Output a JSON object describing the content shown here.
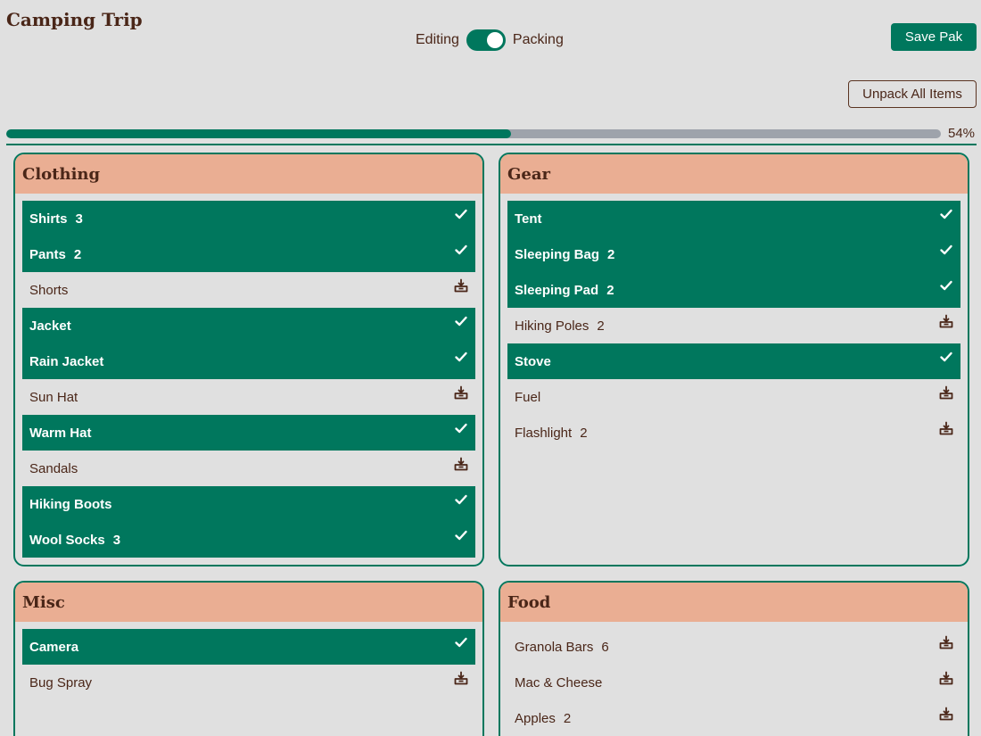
{
  "header": {
    "title": "Camping Trip",
    "mode_left": "Editing",
    "mode_right": "Packing",
    "save_label": "Save Pak",
    "unpack_label": "Unpack All Items"
  },
  "progress": {
    "percent": 54,
    "label": "54%"
  },
  "colors": {
    "accent": "#00775d",
    "header_bg": "#eaae93",
    "text": "#4a2618",
    "background": "#e0e0e0"
  },
  "categories": [
    {
      "id": "clothing",
      "title": "Clothing",
      "items": [
        {
          "name": "Shirts",
          "qty": "3",
          "packed": true
        },
        {
          "name": "Pants",
          "qty": "2",
          "packed": true
        },
        {
          "name": "Shorts",
          "qty": "",
          "packed": false
        },
        {
          "name": "Jacket",
          "qty": "",
          "packed": true
        },
        {
          "name": "Rain Jacket",
          "qty": "",
          "packed": true
        },
        {
          "name": "Sun Hat",
          "qty": "",
          "packed": false
        },
        {
          "name": "Warm Hat",
          "qty": "",
          "packed": true
        },
        {
          "name": "Sandals",
          "qty": "",
          "packed": false
        },
        {
          "name": "Hiking Boots",
          "qty": "",
          "packed": true
        },
        {
          "name": "Wool Socks",
          "qty": "3",
          "packed": true
        }
      ]
    },
    {
      "id": "gear",
      "title": "Gear",
      "items": [
        {
          "name": "Tent",
          "qty": "",
          "packed": true
        },
        {
          "name": "Sleeping Bag",
          "qty": "2",
          "packed": true
        },
        {
          "name": "Sleeping Pad",
          "qty": "2",
          "packed": true
        },
        {
          "name": "Hiking Poles",
          "qty": "2",
          "packed": false
        },
        {
          "name": "Stove",
          "qty": "",
          "packed": true
        },
        {
          "name": "Fuel",
          "qty": "",
          "packed": false
        },
        {
          "name": "Flashlight",
          "qty": "2",
          "packed": false
        }
      ]
    },
    {
      "id": "misc",
      "title": "Misc",
      "items": [
        {
          "name": "Camera",
          "qty": "",
          "packed": true
        },
        {
          "name": "Bug Spray",
          "qty": "",
          "packed": false
        }
      ]
    },
    {
      "id": "food",
      "title": "Food",
      "items": [
        {
          "name": "Granola Bars",
          "qty": "6",
          "packed": false
        },
        {
          "name": "Mac & Cheese",
          "qty": "",
          "packed": false
        },
        {
          "name": "Apples",
          "qty": "2",
          "packed": false
        }
      ]
    }
  ]
}
